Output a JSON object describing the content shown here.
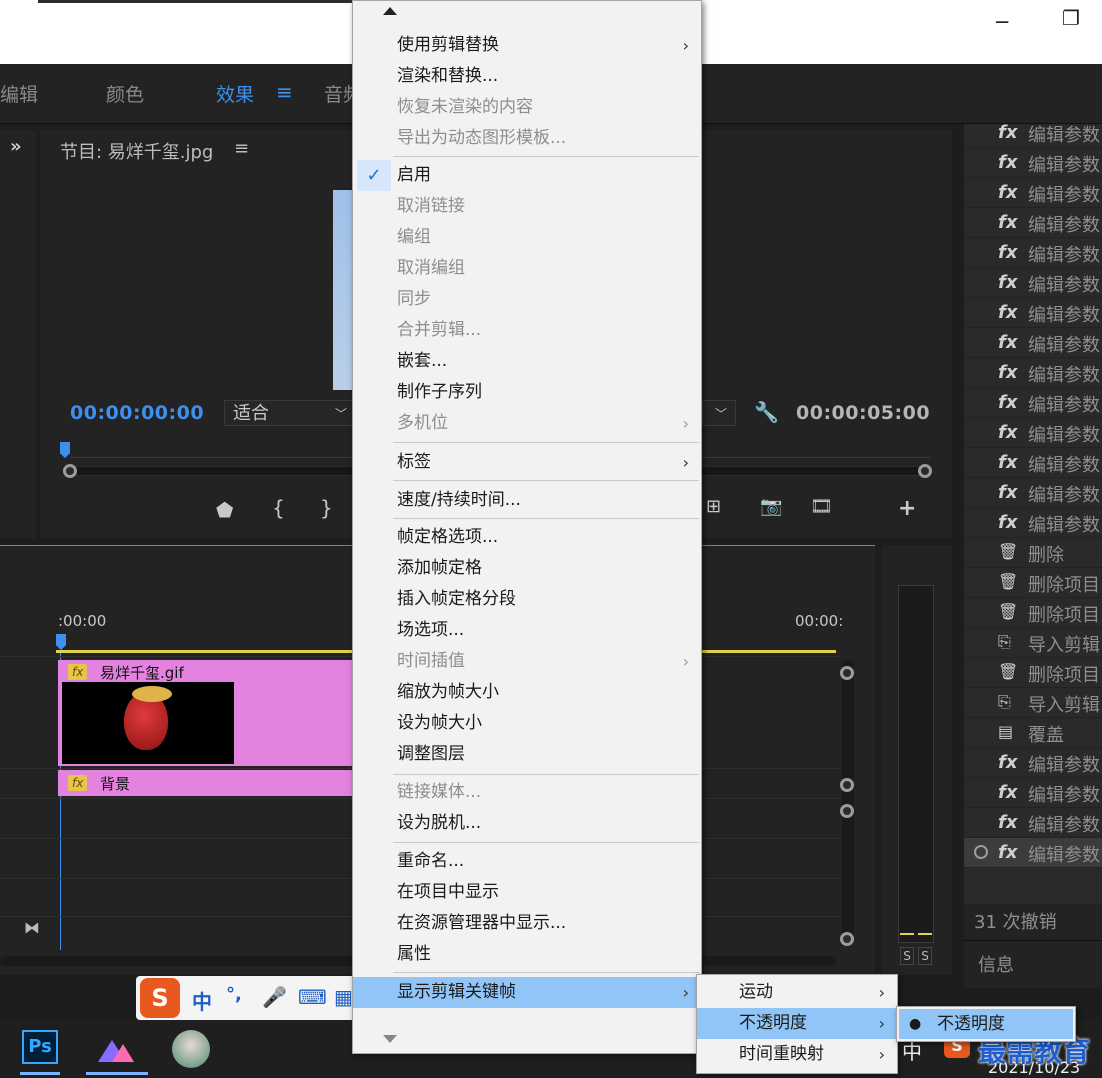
{
  "colors": {
    "accent": "#3d8ff0",
    "clip_pink": "#e482e0",
    "fx_yellow": "#e6c54b",
    "menu_highlight": "#92c5f7"
  },
  "workspaces": [
    {
      "label": "编辑"
    },
    {
      "label": "颜色"
    },
    {
      "label": "效果"
    },
    {
      "label": "音频"
    }
  ],
  "monitor": {
    "title": "节目: 易烊千玺.jpg",
    "current_time": "00:00:00:00",
    "fit_select": "适合",
    "duration": "00:00:05:00"
  },
  "timeline": {
    "ruler_start": ":00:00",
    "ruler_end": "00:00:",
    "clip_top": {
      "name": "易烊千玺.gif",
      "fx": "fx"
    },
    "clip_bottom": {
      "name": "背景",
      "fx": "fx"
    }
  },
  "meter": {
    "solo_left": "S",
    "solo_right": "S"
  },
  "history": {
    "items": [
      {
        "icon": "fx-icon",
        "glyph": "fx",
        "label": "编辑参数"
      },
      {
        "icon": "fx-icon",
        "glyph": "fx",
        "label": "编辑参数"
      },
      {
        "icon": "fx-icon",
        "glyph": "fx",
        "label": "编辑参数"
      },
      {
        "icon": "fx-icon",
        "glyph": "fx",
        "label": "编辑参数"
      },
      {
        "icon": "fx-icon",
        "glyph": "fx",
        "label": "编辑参数"
      },
      {
        "icon": "fx-icon",
        "glyph": "fx",
        "label": "编辑参数"
      },
      {
        "icon": "fx-icon",
        "glyph": "fx",
        "label": "编辑参数"
      },
      {
        "icon": "fx-icon",
        "glyph": "fx",
        "label": "编辑参数"
      },
      {
        "icon": "fx-icon",
        "glyph": "fx",
        "label": "编辑参数"
      },
      {
        "icon": "fx-icon",
        "glyph": "fx",
        "label": "编辑参数"
      },
      {
        "icon": "fx-icon",
        "glyph": "fx",
        "label": "编辑参数"
      },
      {
        "icon": "fx-icon",
        "glyph": "fx",
        "label": "编辑参数"
      },
      {
        "icon": "fx-icon",
        "glyph": "fx",
        "label": "编辑参数"
      },
      {
        "icon": "fx-icon",
        "glyph": "fx",
        "label": "编辑参数"
      },
      {
        "icon": "trash-icon",
        "glyph": "🗑",
        "label": "删除"
      },
      {
        "icon": "trash-icon",
        "glyph": "🗑",
        "label": "删除项目"
      },
      {
        "icon": "trash-icon",
        "glyph": "🗑",
        "label": "删除项目"
      },
      {
        "icon": "import-icon",
        "glyph": "⎘",
        "label": "导入剪辑"
      },
      {
        "icon": "trash-icon",
        "glyph": "🗑",
        "label": "删除项目"
      },
      {
        "icon": "import-icon",
        "glyph": "⎘",
        "label": "导入剪辑"
      },
      {
        "icon": "overlay-icon",
        "glyph": "▤",
        "label": "覆盖"
      },
      {
        "icon": "fx-icon",
        "glyph": "fx",
        "label": "编辑参数"
      },
      {
        "icon": "fx-icon",
        "glyph": "fx",
        "label": "编辑参数"
      },
      {
        "icon": "fx-icon",
        "glyph": "fx",
        "label": "编辑参数"
      },
      {
        "icon": "fx-icon",
        "glyph": "fx",
        "label": "编辑参数"
      }
    ],
    "undo_count": "31 次撤销",
    "info_label": "信息"
  },
  "context_menu": {
    "items": [
      {
        "label": "使用剪辑替换",
        "disabled": false,
        "submenu": true
      },
      {
        "label": "渲染和替换...",
        "disabled": false,
        "submenu": false
      },
      {
        "label": "恢复未渲染的内容",
        "disabled": true,
        "submenu": false
      },
      {
        "label": "导出为动态图形模板...",
        "disabled": true,
        "submenu": false
      },
      {
        "label": "启用",
        "disabled": false,
        "submenu": false,
        "checked": true
      },
      {
        "label": "取消链接",
        "disabled": true,
        "submenu": false
      },
      {
        "label": "编组",
        "disabled": true,
        "submenu": false
      },
      {
        "label": "取消编组",
        "disabled": true,
        "submenu": false
      },
      {
        "label": "同步",
        "disabled": true,
        "submenu": false
      },
      {
        "label": "合并剪辑...",
        "disabled": true,
        "submenu": false
      },
      {
        "label": "嵌套...",
        "disabled": false,
        "submenu": false
      },
      {
        "label": "制作子序列",
        "disabled": false,
        "submenu": false
      },
      {
        "label": "多机位",
        "disabled": true,
        "submenu": true
      },
      {
        "label": "标签",
        "disabled": false,
        "submenu": true
      },
      {
        "label": "速度/持续时间...",
        "disabled": false,
        "submenu": false
      },
      {
        "label": "帧定格选项...",
        "disabled": false,
        "submenu": false
      },
      {
        "label": "添加帧定格",
        "disabled": false,
        "submenu": false
      },
      {
        "label": "插入帧定格分段",
        "disabled": false,
        "submenu": false
      },
      {
        "label": "场选项...",
        "disabled": false,
        "submenu": false
      },
      {
        "label": "时间插值",
        "disabled": true,
        "submenu": true
      },
      {
        "label": "缩放为帧大小",
        "disabled": false,
        "submenu": false
      },
      {
        "label": "设为帧大小",
        "disabled": false,
        "submenu": false
      },
      {
        "label": "调整图层",
        "disabled": false,
        "submenu": false
      },
      {
        "label": "链接媒体...",
        "disabled": true,
        "submenu": false
      },
      {
        "label": "设为脱机...",
        "disabled": false,
        "submenu": false
      },
      {
        "label": "重命名...",
        "disabled": false,
        "submenu": false
      },
      {
        "label": "在项目中显示",
        "disabled": false,
        "submenu": false
      },
      {
        "label": "在资源管理器中显示...",
        "disabled": false,
        "submenu": false
      },
      {
        "label": "属性",
        "disabled": false,
        "submenu": false
      },
      {
        "label": "显示剪辑关键帧",
        "disabled": false,
        "submenu": true,
        "highlighted": true
      }
    ]
  },
  "submenu_keyframes": {
    "items": [
      {
        "label": "运动"
      },
      {
        "label": "不透明度"
      },
      {
        "label": "时间重映射"
      }
    ]
  },
  "submenu_opacity": {
    "items": [
      {
        "label": "不透明度",
        "selected": true
      }
    ]
  },
  "ime": {
    "mode": "中",
    "punct": "°,"
  },
  "taskbar": {
    "ps_label": "Ps",
    "tray_lang": "中",
    "date": "2021/10/23",
    "watermark": "最需教育"
  }
}
